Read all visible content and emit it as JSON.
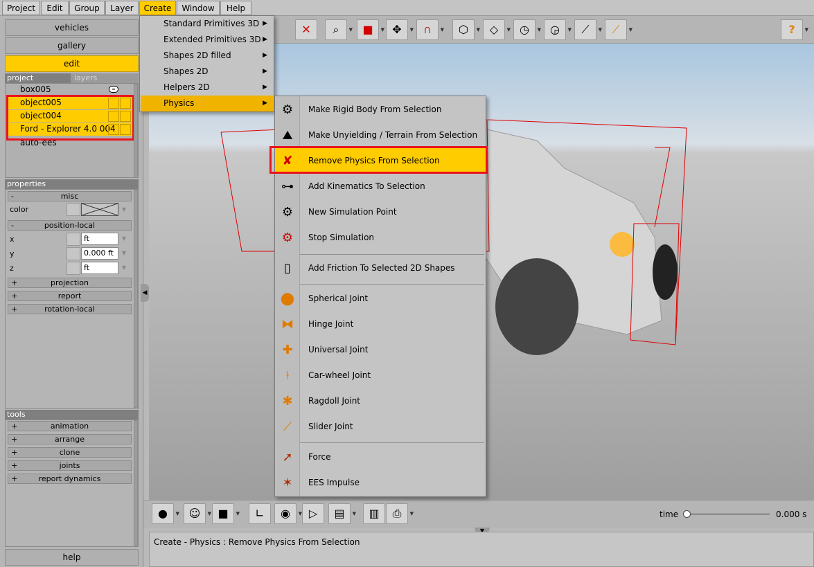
{
  "menubar": {
    "items": [
      {
        "label": "Project"
      },
      {
        "label": "Edit"
      },
      {
        "label": "Group"
      },
      {
        "label": "Layer"
      },
      {
        "label": "Create"
      },
      {
        "label": "Window"
      },
      {
        "label": "Help"
      }
    ]
  },
  "sidebar": {
    "nav": {
      "vehicles": "vehicles",
      "gallery": "gallery",
      "edit": "edit"
    },
    "tabs": {
      "project": "project",
      "layers": "layers"
    },
    "objects": [
      {
        "name": "box005"
      },
      {
        "name": "object005"
      },
      {
        "name": "object004"
      },
      {
        "name": "Ford - Explorer 4.0 004"
      },
      {
        "name": "auto-ees"
      }
    ],
    "properties": {
      "header": "properties",
      "misc": "misc",
      "color_label": "color",
      "position_local": "position-local",
      "x_label": "x",
      "x_value": "ft",
      "y_label": "y",
      "y_value": "0.000 ft",
      "z_label": "z",
      "z_value": "ft",
      "projection": "projection",
      "report": "report",
      "rotation_local": "rotation-local"
    },
    "tools": {
      "header": "tools",
      "items": [
        "animation",
        "arrange",
        "clone",
        "joints",
        "report dynamics"
      ]
    },
    "help": "help"
  },
  "create_menu": {
    "items": [
      {
        "label": "Standard Primitives 3D"
      },
      {
        "label": "Extended Primitives 3D"
      },
      {
        "label": "Shapes 2D filled"
      },
      {
        "label": "Shapes 2D"
      },
      {
        "label": "Helpers 2D"
      },
      {
        "label": "Physics"
      }
    ]
  },
  "physics_menu": {
    "items": [
      {
        "label": "Make Rigid Body From Selection",
        "icon": "gears-icon"
      },
      {
        "label": "Make Unyielding / Terrain From Selection",
        "icon": "terrain-icon"
      },
      {
        "label": "Remove Physics From Selection",
        "icon": "remove-physics-icon"
      },
      {
        "label": "Add Kinematics To Selection",
        "icon": "kinematics-icon"
      },
      {
        "label": "New Simulation Point",
        "icon": "simulation-point-icon"
      },
      {
        "label": "Stop Simulation",
        "icon": "stop-simulation-icon"
      },
      {
        "label": "Add Friction To Selected 2D Shapes",
        "icon": "friction-icon"
      },
      {
        "label": "Spherical Joint",
        "icon": "spherical-joint-icon"
      },
      {
        "label": "Hinge Joint",
        "icon": "hinge-joint-icon"
      },
      {
        "label": "Universal Joint",
        "icon": "universal-joint-icon"
      },
      {
        "label": "Car-wheel Joint",
        "icon": "car-wheel-joint-icon"
      },
      {
        "label": "Ragdoll Joint",
        "icon": "ragdoll-joint-icon"
      },
      {
        "label": "Slider Joint",
        "icon": "slider-joint-icon"
      },
      {
        "label": "Force",
        "icon": "force-icon"
      },
      {
        "label": "EES Impulse",
        "icon": "ees-impulse-icon"
      }
    ]
  },
  "timeline": {
    "label": "time",
    "value": "0.000 s",
    "fraction": 0.0
  },
  "status": {
    "text": "Create - Physics : Remove Physics From Selection"
  },
  "colors": {
    "accent": "#ffcc00",
    "highlight_border": "#e8141e",
    "menu_hover": "#f0b400"
  }
}
